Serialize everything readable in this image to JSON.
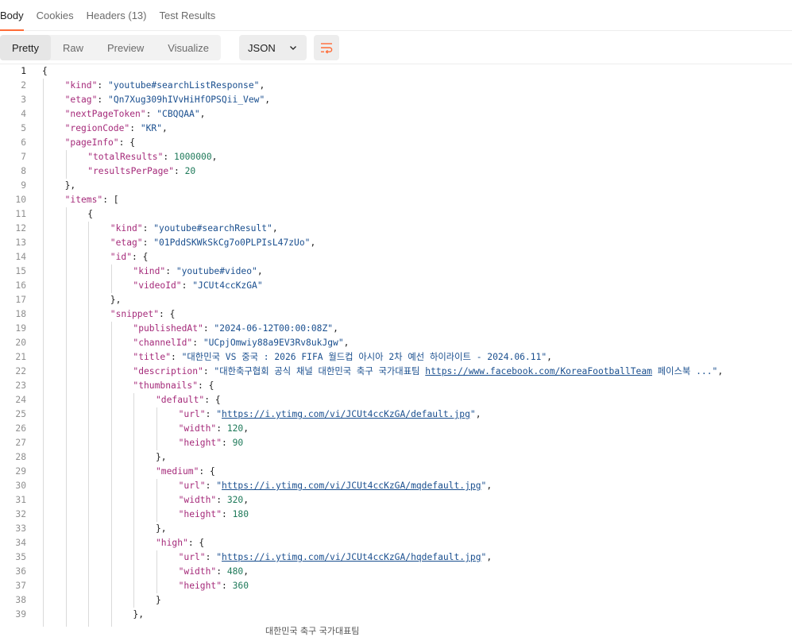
{
  "tabs": [
    {
      "label": "Body",
      "active": true
    },
    {
      "label": "Cookies",
      "active": false
    },
    {
      "label": "Headers (13)",
      "active": false
    },
    {
      "label": "Test Results",
      "active": false
    }
  ],
  "view_modes": [
    {
      "label": "Pretty",
      "active": true
    },
    {
      "label": "Raw",
      "active": false
    },
    {
      "label": "Preview",
      "active": false
    },
    {
      "label": "Visualize",
      "active": false
    }
  ],
  "format": {
    "selected": "JSON",
    "icon": "chevron-down-icon"
  },
  "wrap_icon": "wrap-lines-icon",
  "colors": {
    "accent": "#ff6c37",
    "key": "#a52a7a",
    "string": "#1a4f8f",
    "number": "#1f7a5a"
  },
  "code_lines": [
    {
      "n": "1",
      "d": 0,
      "t": [
        [
          "p",
          "{"
        ]
      ]
    },
    {
      "n": "2",
      "d": 1,
      "t": [
        [
          "k",
          "\"kind\""
        ],
        [
          "p",
          ": "
        ],
        [
          "s",
          "\"youtube#searchListResponse\""
        ],
        [
          "p",
          ","
        ]
      ]
    },
    {
      "n": "3",
      "d": 1,
      "t": [
        [
          "k",
          "\"etag\""
        ],
        [
          "p",
          ": "
        ],
        [
          "s",
          "\"Qn7Xug309hIVvHiHfOPSQii_Vew\""
        ],
        [
          "p",
          ","
        ]
      ]
    },
    {
      "n": "4",
      "d": 1,
      "t": [
        [
          "k",
          "\"nextPageToken\""
        ],
        [
          "p",
          ": "
        ],
        [
          "s",
          "\"CBQQAA\""
        ],
        [
          "p",
          ","
        ]
      ]
    },
    {
      "n": "5",
      "d": 1,
      "t": [
        [
          "k",
          "\"regionCode\""
        ],
        [
          "p",
          ": "
        ],
        [
          "s",
          "\"KR\""
        ],
        [
          "p",
          ","
        ]
      ]
    },
    {
      "n": "6",
      "d": 1,
      "t": [
        [
          "k",
          "\"pageInfo\""
        ],
        [
          "p",
          ": {"
        ]
      ]
    },
    {
      "n": "7",
      "d": 2,
      "t": [
        [
          "k",
          "\"totalResults\""
        ],
        [
          "p",
          ": "
        ],
        [
          "n",
          "1000000"
        ],
        [
          "p",
          ","
        ]
      ]
    },
    {
      "n": "8",
      "d": 2,
      "t": [
        [
          "k",
          "\"resultsPerPage\""
        ],
        [
          "p",
          ": "
        ],
        [
          "n",
          "20"
        ]
      ]
    },
    {
      "n": "9",
      "d": 1,
      "t": [
        [
          "p",
          "},"
        ]
      ]
    },
    {
      "n": "10",
      "d": 1,
      "t": [
        [
          "k",
          "\"items\""
        ],
        [
          "p",
          ": ["
        ]
      ]
    },
    {
      "n": "11",
      "d": 2,
      "t": [
        [
          "p",
          "{"
        ]
      ]
    },
    {
      "n": "12",
      "d": 3,
      "t": [
        [
          "k",
          "\"kind\""
        ],
        [
          "p",
          ": "
        ],
        [
          "s",
          "\"youtube#searchResult\""
        ],
        [
          "p",
          ","
        ]
      ]
    },
    {
      "n": "13",
      "d": 3,
      "t": [
        [
          "k",
          "\"etag\""
        ],
        [
          "p",
          ": "
        ],
        [
          "s",
          "\"01PddSKWkSkCg7o0PLPIsL47zUo\""
        ],
        [
          "p",
          ","
        ]
      ]
    },
    {
      "n": "14",
      "d": 3,
      "t": [
        [
          "k",
          "\"id\""
        ],
        [
          "p",
          ": {"
        ]
      ]
    },
    {
      "n": "15",
      "d": 4,
      "t": [
        [
          "k",
          "\"kind\""
        ],
        [
          "p",
          ": "
        ],
        [
          "s",
          "\"youtube#video\""
        ],
        [
          "p",
          ","
        ]
      ]
    },
    {
      "n": "16",
      "d": 4,
      "t": [
        [
          "k",
          "\"videoId\""
        ],
        [
          "p",
          ": "
        ],
        [
          "s",
          "\"JCUt4ccKzGA\""
        ]
      ]
    },
    {
      "n": "17",
      "d": 3,
      "t": [
        [
          "p",
          "},"
        ]
      ]
    },
    {
      "n": "18",
      "d": 3,
      "t": [
        [
          "k",
          "\"snippet\""
        ],
        [
          "p",
          ": {"
        ]
      ]
    },
    {
      "n": "19",
      "d": 4,
      "t": [
        [
          "k",
          "\"publishedAt\""
        ],
        [
          "p",
          ": "
        ],
        [
          "s",
          "\"2024-06-12T00:00:08Z\""
        ],
        [
          "p",
          ","
        ]
      ]
    },
    {
      "n": "20",
      "d": 4,
      "t": [
        [
          "k",
          "\"channelId\""
        ],
        [
          "p",
          ": "
        ],
        [
          "s",
          "\"UCpjOmwiy88a9EV3Rv8ukJgw\""
        ],
        [
          "p",
          ","
        ]
      ]
    },
    {
      "n": "21",
      "d": 4,
      "t": [
        [
          "k",
          "\"title\""
        ],
        [
          "p",
          ": "
        ],
        [
          "s",
          "\"대한민국 VS 중국 : 2026 FIFA 월드컵 아시아 2차 예선 하이라이트 - 2024.06.11\""
        ],
        [
          "p",
          ","
        ]
      ]
    },
    {
      "n": "22",
      "d": 4,
      "t": [
        [
          "k",
          "\"description\""
        ],
        [
          "p",
          ": "
        ],
        [
          "s",
          "\"대한축구협회 공식 채널 대한민국 축구 국가대표팀 "
        ],
        [
          "u",
          "https://www.facebook.com/KoreaFootballTeam"
        ],
        [
          "s",
          " 페이스북 ...\""
        ],
        [
          "p",
          ","
        ]
      ]
    },
    {
      "n": "23",
      "d": 4,
      "t": [
        [
          "k",
          "\"thumbnails\""
        ],
        [
          "p",
          ": {"
        ]
      ]
    },
    {
      "n": "24",
      "d": 5,
      "t": [
        [
          "k",
          "\"default\""
        ],
        [
          "p",
          ": {"
        ]
      ]
    },
    {
      "n": "25",
      "d": 6,
      "t": [
        [
          "k",
          "\"url\""
        ],
        [
          "p",
          ": "
        ],
        [
          "s",
          "\""
        ],
        [
          "u",
          "https://i.ytimg.com/vi/JCUt4ccKzGA/default.jpg"
        ],
        [
          "s",
          "\""
        ],
        [
          "p",
          ","
        ]
      ]
    },
    {
      "n": "26",
      "d": 6,
      "t": [
        [
          "k",
          "\"width\""
        ],
        [
          "p",
          ": "
        ],
        [
          "n",
          "120"
        ],
        [
          "p",
          ","
        ]
      ]
    },
    {
      "n": "27",
      "d": 6,
      "t": [
        [
          "k",
          "\"height\""
        ],
        [
          "p",
          ": "
        ],
        [
          "n",
          "90"
        ]
      ]
    },
    {
      "n": "28",
      "d": 5,
      "t": [
        [
          "p",
          "},"
        ]
      ]
    },
    {
      "n": "29",
      "d": 5,
      "t": [
        [
          "k",
          "\"medium\""
        ],
        [
          "p",
          ": {"
        ]
      ]
    },
    {
      "n": "30",
      "d": 6,
      "t": [
        [
          "k",
          "\"url\""
        ],
        [
          "p",
          ": "
        ],
        [
          "s",
          "\""
        ],
        [
          "u",
          "https://i.ytimg.com/vi/JCUt4ccKzGA/mqdefault.jpg"
        ],
        [
          "s",
          "\""
        ],
        [
          "p",
          ","
        ]
      ]
    },
    {
      "n": "31",
      "d": 6,
      "t": [
        [
          "k",
          "\"width\""
        ],
        [
          "p",
          ": "
        ],
        [
          "n",
          "320"
        ],
        [
          "p",
          ","
        ]
      ]
    },
    {
      "n": "32",
      "d": 6,
      "t": [
        [
          "k",
          "\"height\""
        ],
        [
          "p",
          ": "
        ],
        [
          "n",
          "180"
        ]
      ]
    },
    {
      "n": "33",
      "d": 5,
      "t": [
        [
          "p",
          "},"
        ]
      ]
    },
    {
      "n": "34",
      "d": 5,
      "t": [
        [
          "k",
          "\"high\""
        ],
        [
          "p",
          ": {"
        ]
      ]
    },
    {
      "n": "35",
      "d": 6,
      "t": [
        [
          "k",
          "\"url\""
        ],
        [
          "p",
          ": "
        ],
        [
          "s",
          "\""
        ],
        [
          "u",
          "https://i.ytimg.com/vi/JCUt4ccKzGA/hqdefault.jpg"
        ],
        [
          "s",
          "\""
        ],
        [
          "p",
          ","
        ]
      ]
    },
    {
      "n": "36",
      "d": 6,
      "t": [
        [
          "k",
          "\"width\""
        ],
        [
          "p",
          ": "
        ],
        [
          "n",
          "480"
        ],
        [
          "p",
          ","
        ]
      ]
    },
    {
      "n": "37",
      "d": 6,
      "t": [
        [
          "k",
          "\"height\""
        ],
        [
          "p",
          ": "
        ],
        [
          "n",
          "360"
        ]
      ]
    },
    {
      "n": "38",
      "d": 5,
      "t": [
        [
          "p",
          "}"
        ]
      ]
    },
    {
      "n": "39",
      "d": 4,
      "t": [
        [
          "p",
          "},"
        ]
      ]
    }
  ],
  "cut_text": "대한민국 축구 국가대표팀"
}
